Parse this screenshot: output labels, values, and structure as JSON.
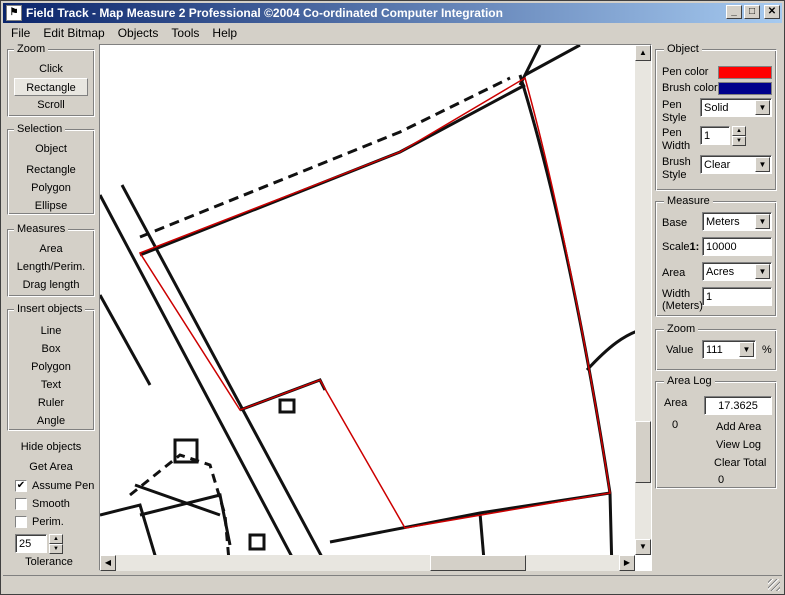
{
  "window": {
    "title": "Field Track - Map Measure 2 Professional  ©2004 Co-ordinated Computer Integration",
    "app_icon": "map-icon",
    "controls": [
      "minimize-icon",
      "maximize-icon",
      "close-icon"
    ]
  },
  "menu": [
    "File",
    "Edit Bitmap",
    "Objects",
    "Tools",
    "Help"
  ],
  "left": {
    "zoom": {
      "label": "Zoom",
      "items": [
        "Click",
        "Rectangle",
        "Scroll"
      ],
      "selected": "Rectangle"
    },
    "selection": {
      "label": "Selection",
      "items": [
        "Object",
        "Rectangle",
        "Polygon",
        "Ellipse"
      ]
    },
    "measures": {
      "label": "Measures",
      "items": [
        "Area",
        "Length/Perim.",
        "Drag length"
      ]
    },
    "insert": {
      "label": "Insert objects",
      "items": [
        "Line",
        "Box",
        "Polygon",
        "Text",
        "Ruler",
        "Angle"
      ]
    },
    "hide_objects": "Hide objects",
    "get_area": "Get Area",
    "assume_pen": {
      "label": "Assume Pen",
      "checked": true
    },
    "smooth": {
      "label": "Smooth",
      "checked": false
    },
    "perim": {
      "label": "Perim.",
      "checked": false
    },
    "tolerance_value": "25",
    "tolerance_label": "Tolerance"
  },
  "object_panel": {
    "label": "Object",
    "pen_color_label": "Pen color",
    "pen_color": "#ff0000",
    "brush_color_label": "Brush color",
    "brush_color": "#00008b",
    "pen_style_label": "Pen Style",
    "pen_style": "Solid",
    "pen_width_label": "Pen Width",
    "pen_width": "1",
    "brush_style_label": "Brush Style",
    "brush_style": "Clear"
  },
  "measure_panel": {
    "label": "Measure",
    "base_label": "Base",
    "base": "Meters",
    "scale_label": "Scale",
    "scale_prefix": "1:",
    "scale": "10000",
    "area_label": "Area",
    "area_unit": "Acres",
    "width_label": "Width (Meters)",
    "width": "1"
  },
  "zoom_panel": {
    "label": "Zoom",
    "value_label": "Value",
    "value": "111",
    "unit": "%"
  },
  "area_log": {
    "label": "Area Log",
    "area_label": "Area",
    "area_value": "17.3625",
    "count": "0",
    "add_area": "Add Area",
    "view_log": "View Log",
    "clear_total": "Clear Total",
    "total": "0"
  },
  "scroll": {
    "up": "scroll-up-icon",
    "down": "scroll-down-icon",
    "left": "scroll-left-icon",
    "right": "scroll-right-icon"
  }
}
